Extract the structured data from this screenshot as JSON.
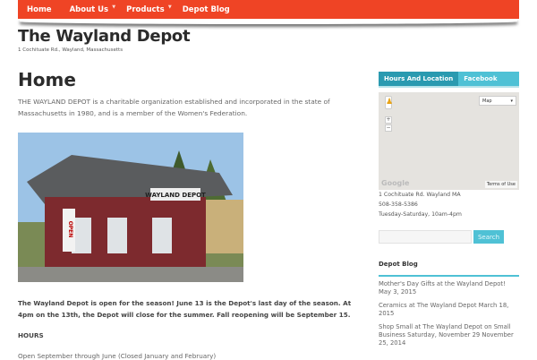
{
  "nav": [
    {
      "label": "Home"
    },
    {
      "label": "About Us",
      "caret": "▼"
    },
    {
      "label": "Products",
      "caret": "▼"
    },
    {
      "label": "Depot Blog"
    }
  ],
  "site": {
    "title": "The Wayland Depot",
    "tagline": "1 Cochituate Rd., Wayland, Massachusetts"
  },
  "page": {
    "title": "Home",
    "intro": "THE WAYLAND DEPOT is a charitable organization established and incorporated in the state of Massachusetts in 1980, and is a member of the Women's Federation.",
    "photo_sign": "WAYLAND DEPOT",
    "photo_flag": "OPEN",
    "announcement": "The Wayland Depot is open for the season!  June 13 is the Depot's last day of the season.  At 4pm on the 13th, the Depot will close for the summer.  Fall reopening will be September 15.",
    "hours_heading": "HOURS",
    "hours_text": "Open September through June (Closed January and February)"
  },
  "sidebar": {
    "tabs": [
      {
        "label": "Hours And Location"
      },
      {
        "label": "Facebook"
      }
    ],
    "map": {
      "type": "Map",
      "caret": "▾",
      "plus": "+",
      "minus": "−",
      "google": "Google",
      "terms": "Terms of Use"
    },
    "address": "1 Cochituate Rd. Wayland MA",
    "phone": "508-358-5386",
    "hours": "Tuesday-Saturday, 10am-4pm",
    "search_button": "Search",
    "search_placeholder": "",
    "blog_title": "Depot Blog",
    "posts": [
      "Mother's Day Gifts at the Wayland Depot! May 3, 2015",
      "Ceramics at The Wayland Depot March 18, 2015",
      "Shop Small at The Wayland Depot on Small Business Saturday, November 29 November 25, 2014"
    ]
  }
}
